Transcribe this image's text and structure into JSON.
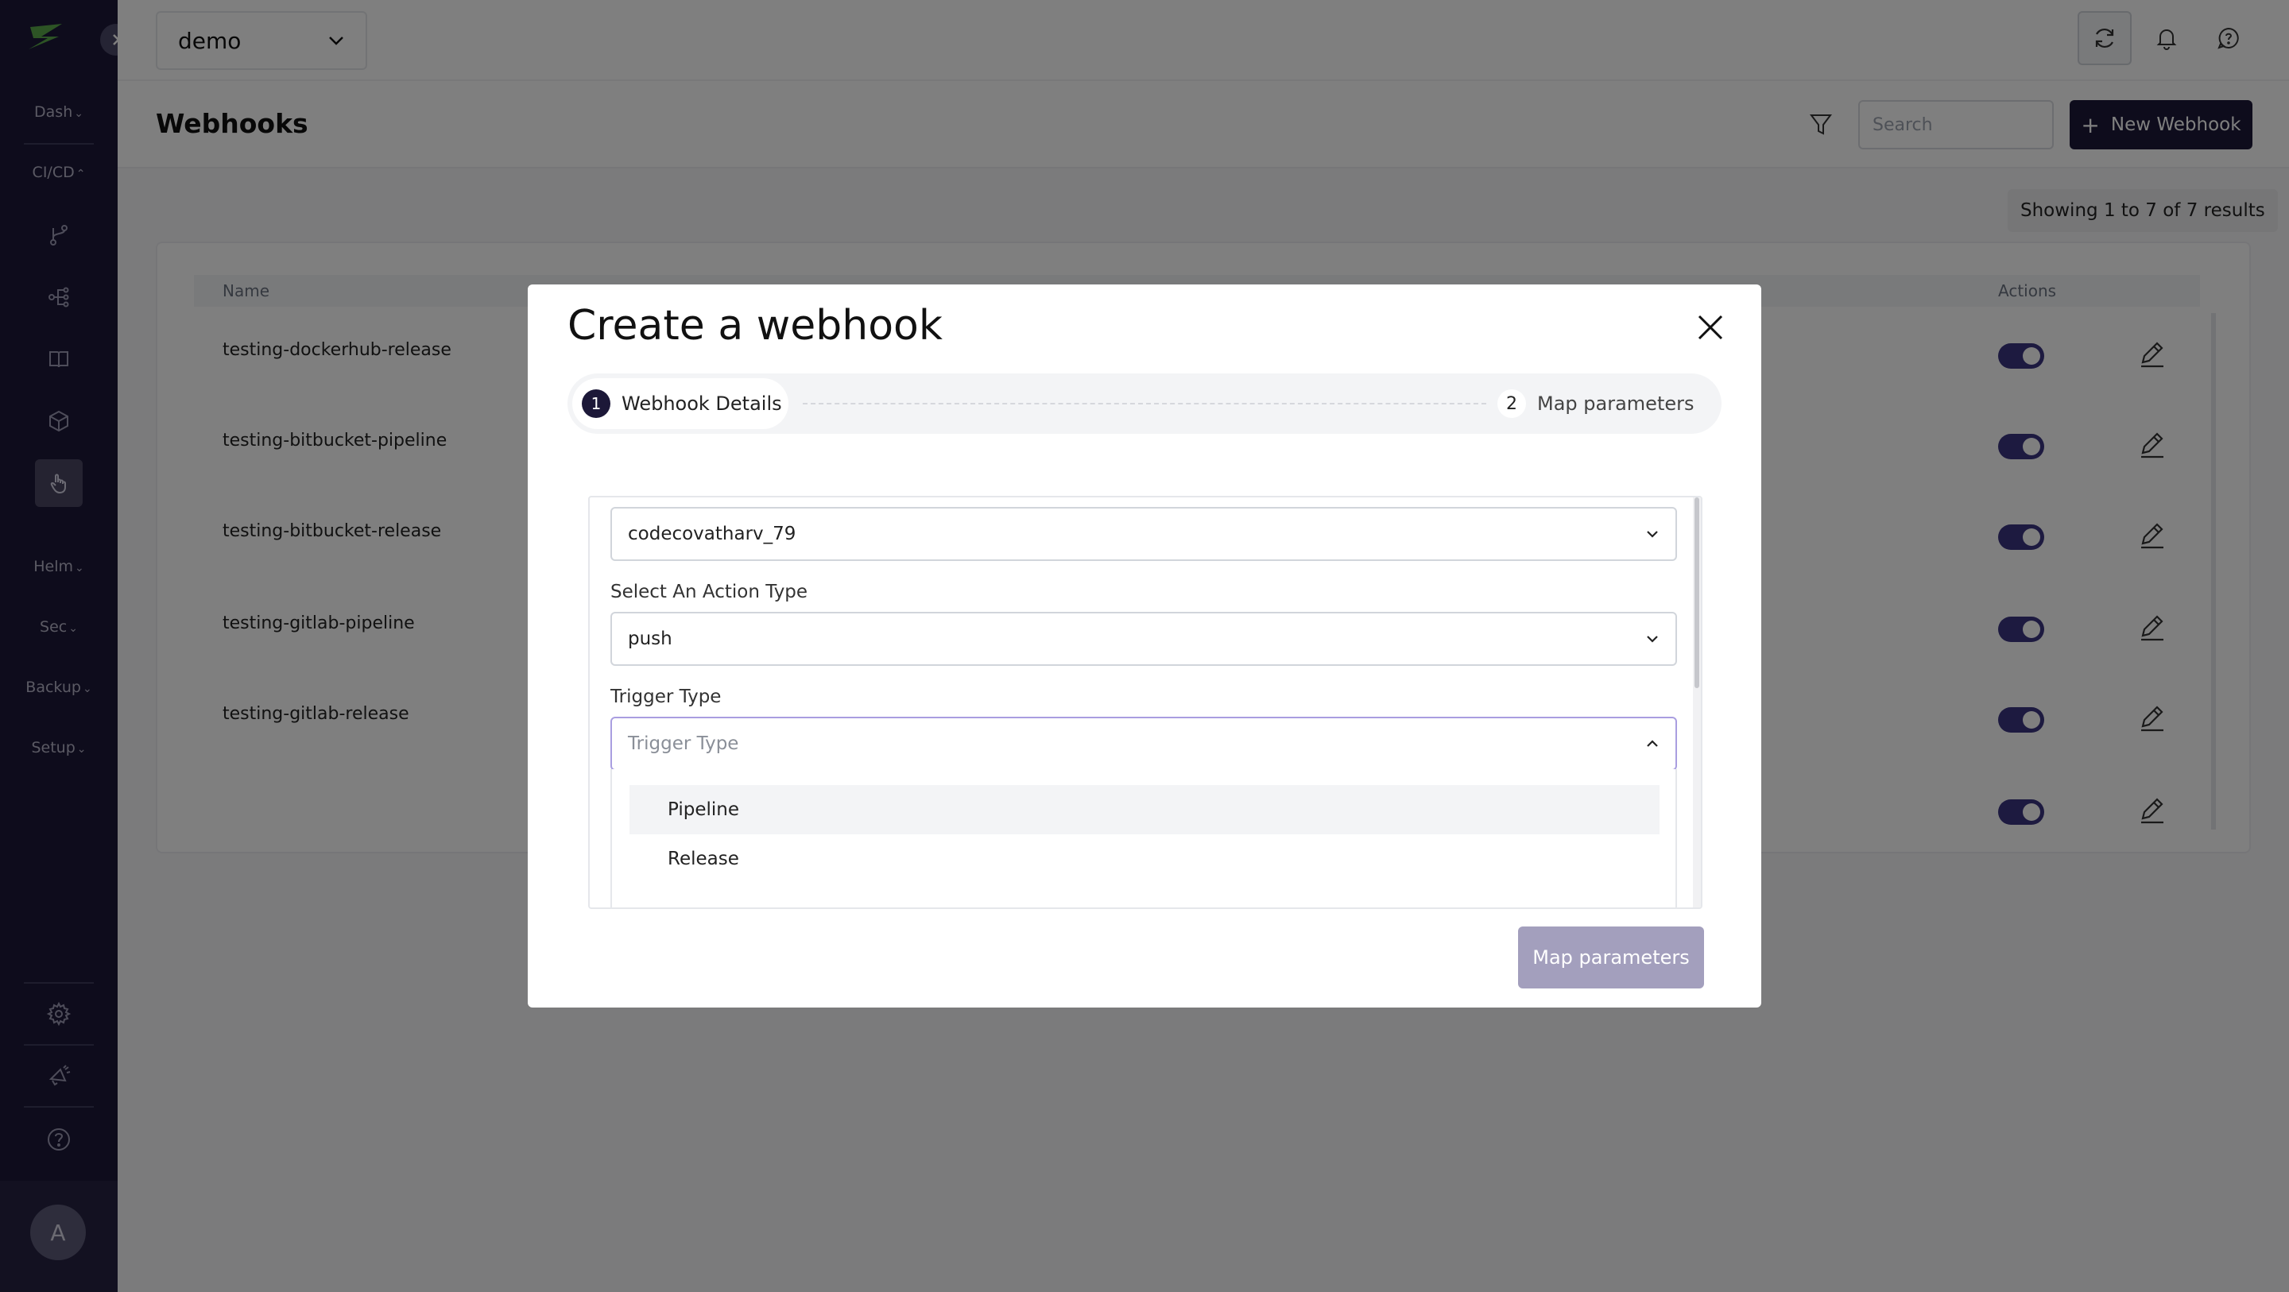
{
  "sidebar": {
    "menus": [
      {
        "label": "Dash",
        "expanded": false
      },
      {
        "label": "CI/CD",
        "expanded": true
      },
      {
        "label": "Helm",
        "expanded": false
      },
      {
        "label": "Sec",
        "expanded": false
      },
      {
        "label": "Backup",
        "expanded": false
      },
      {
        "label": "Setup",
        "expanded": false
      }
    ],
    "avatar_initial": "A",
    "icons": [
      "branch-icon",
      "pipeline-icon",
      "book-icon",
      "package-icon",
      "webhook-icon",
      "settings-icon",
      "announcement-icon",
      "help-icon"
    ]
  },
  "topbar": {
    "workspace": "demo"
  },
  "header": {
    "title": "Webhooks",
    "search_placeholder": "Search",
    "new_button": "New Webhook"
  },
  "table": {
    "showing": "Showing 1 to 7 of 7 results",
    "columns": {
      "name": "Name",
      "actions": "Actions"
    },
    "rows": [
      {
        "name": "testing-dockerhub-release",
        "enabled": true
      },
      {
        "name": "testing-bitbucket-pipeline",
        "enabled": true
      },
      {
        "name": "testing-bitbucket-release",
        "enabled": true
      },
      {
        "name": "testing-gitlab-pipeline",
        "enabled": true
      },
      {
        "name": "testing-gitlab-release",
        "enabled": true
      },
      {
        "name": "",
        "enabled": true
      }
    ]
  },
  "modal": {
    "title": "Create a webhook",
    "steps": [
      {
        "number": "1",
        "label": "Webhook Details"
      },
      {
        "number": "2",
        "label": "Map parameters"
      }
    ],
    "repo_value": "codecovatharv_79",
    "action_label": "Select An Action Type",
    "action_value": "push",
    "trigger_label": "Trigger Type",
    "trigger_placeholder": "Trigger Type",
    "trigger_options": [
      "Pipeline",
      "Release"
    ],
    "submit": "Map parameters"
  },
  "colors": {
    "sidebar_bg": "#1c1838",
    "accent": "#3b3580",
    "disabled_button": "#a39fbd"
  }
}
